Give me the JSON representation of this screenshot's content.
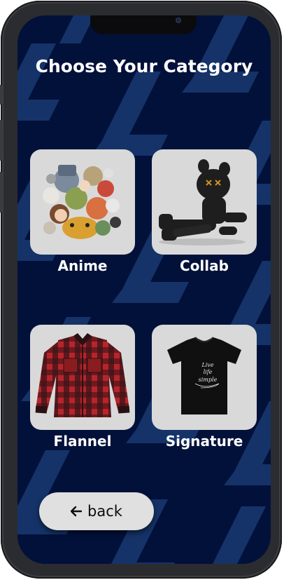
{
  "page": {
    "title": "Choose Your Category"
  },
  "categories": [
    {
      "label": "Anime",
      "icon": "anime-collage-image"
    },
    {
      "label": "Collab",
      "icon": "kaws-figure-image"
    },
    {
      "label": "Flannel",
      "icon": "flannel-shirt-image"
    },
    {
      "label": "Signature",
      "icon": "signature-tshirt-image"
    }
  ],
  "back_button": {
    "label": "back",
    "icon": "arrow-left-icon"
  },
  "tshirt_print": {
    "line1": "Live",
    "line2": "life",
    "line3": "simple"
  },
  "colors": {
    "background": "#02113a",
    "pattern": "#1c3f78",
    "card": "#d9d9d9",
    "button": "#e0e0e0",
    "text": "#ffffff"
  }
}
